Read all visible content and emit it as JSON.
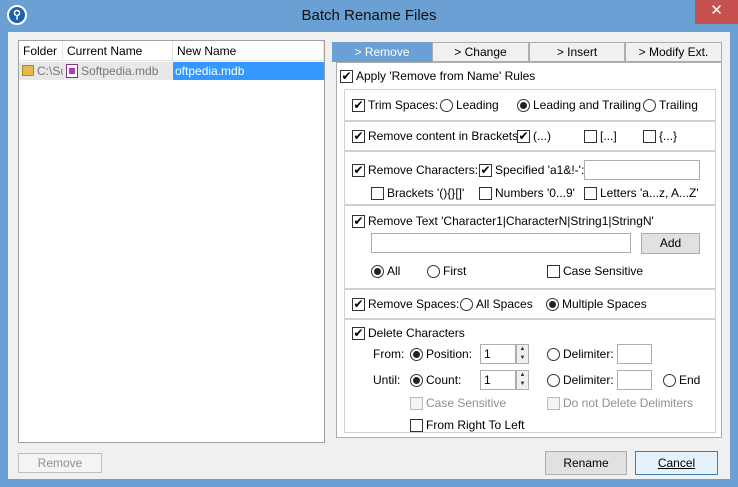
{
  "window": {
    "title": "Batch Rename Files",
    "app_icon_glyph": "⚲",
    "close_glyph": "✕"
  },
  "list": {
    "columns": [
      "Folder",
      "Current Name",
      "New Name"
    ],
    "rows": [
      {
        "folder": "C:\\Sc",
        "current": "Softpedia.mdb",
        "new": "oftpedia.mdb"
      }
    ]
  },
  "tabs": [
    "> Remove",
    "> Change",
    "> Insert",
    "> Modify Ext."
  ],
  "apply_label": "Apply 'Remove from Name' Rules",
  "trim": {
    "label": "Trim Spaces:",
    "leading": "Leading",
    "both": "Leading and Trailing",
    "trailing": "Trailing"
  },
  "brackets": {
    "label": "Remove content in Brackets:",
    "round": "(...)",
    "square": "[...]",
    "curly": "{...}"
  },
  "remove_chars": {
    "label": "Remove Characters:",
    "specified": "Specified 'a1&!-':",
    "specified_value": "",
    "brackets": "Brackets '(){}[]'",
    "numbers": "Numbers '0...9'",
    "letters": "Letters 'a...z, A...Z'"
  },
  "remove_text": {
    "label": "Remove Text  'Character1|CharacterN|String1|StringN'",
    "value": "",
    "add": "Add",
    "all": "All",
    "first": "First",
    "case": "Case Sensitive"
  },
  "remove_spaces": {
    "label": "Remove Spaces:",
    "all": "All Spaces",
    "multiple": "Multiple Spaces"
  },
  "delete_chars": {
    "label": "Delete Characters",
    "from": "From:",
    "until": "Until:",
    "position": "Position:",
    "position_value": "1",
    "count": "Count:",
    "count_value": "1",
    "delimiter": "Delimiter:",
    "end": "End",
    "case": "Case Sensitive",
    "no_delete_delims": "Do not Delete Delimiters",
    "right_to_left": "From Right To Left"
  },
  "buttons": {
    "remove": "Remove",
    "rename": "Rename",
    "cancel": "Cancel"
  },
  "check_glyph": "✔",
  "spin_up": "▲",
  "spin_down": "▼"
}
